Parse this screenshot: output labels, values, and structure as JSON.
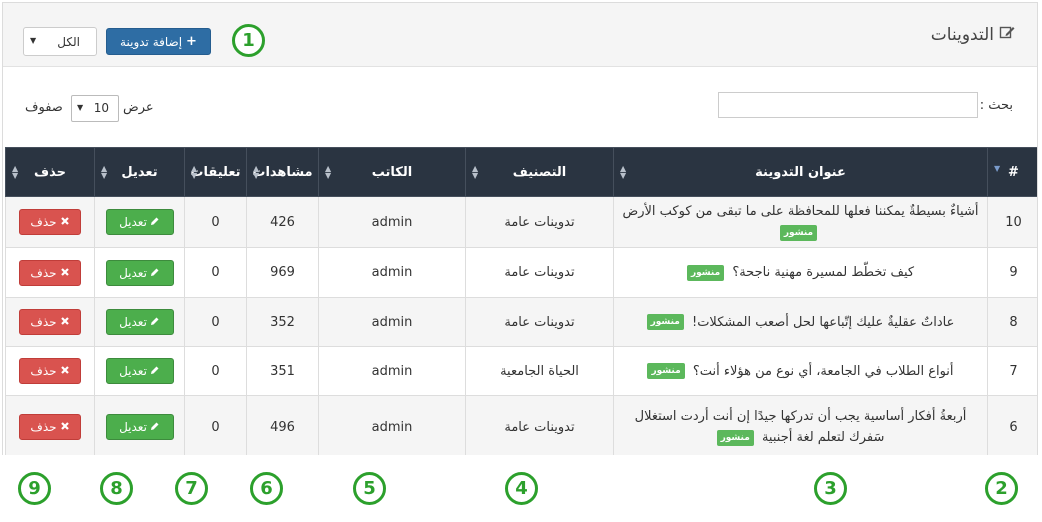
{
  "header": {
    "title": "التدوينات",
    "add_button": "إضافة تدوينة",
    "filter_value": "الكل"
  },
  "controls": {
    "search_label": "بحث :",
    "show_label": "عرض",
    "rows_label": "صفوف",
    "page_length": "10"
  },
  "table": {
    "columns": [
      "#",
      "عنوان التدوينة",
      "التصنيف",
      "الكاتب",
      "مشاهدات",
      "تعليقات",
      "تعديل",
      "حذف"
    ],
    "status_label": "منشور",
    "edit_label": "تعديل",
    "delete_label": "حذف",
    "rows": [
      {
        "id": "10",
        "title": "أشياءٌ بسيطةٌ يمكننا فعلها للمحافظة على ما تبقى من كوكب الأرض",
        "category": "تدوينات عامة",
        "author": "admin",
        "views": "426",
        "comments": "0"
      },
      {
        "id": "9",
        "title": "كيف تخطّط لمسيرة مهنية ناجحة؟",
        "category": "تدوينات عامة",
        "author": "admin",
        "views": "969",
        "comments": "0"
      },
      {
        "id": "8",
        "title": "عاداتٌ عقليةٌ عليك إتّباعها لحل أصعب المشكلات!",
        "category": "تدوينات عامة",
        "author": "admin",
        "views": "352",
        "comments": "0"
      },
      {
        "id": "7",
        "title": "أنواع الطلاب في الجامعة، أي نوع من هؤلاء أنت؟",
        "category": "الحياة الجامعية",
        "author": "admin",
        "views": "351",
        "comments": "0"
      },
      {
        "id": "6",
        "title": "أربعةُ أفكار أساسية يجب أن تدركها جيدًا إن أنت أردت استغلال سَفرك لتعلم لغة أجنبية",
        "category": "تدوينات عامة",
        "author": "admin",
        "views": "496",
        "comments": "0"
      }
    ]
  },
  "callouts": [
    "1",
    "2",
    "3",
    "4",
    "5",
    "6",
    "7",
    "8",
    "9"
  ],
  "colors": {
    "header_dark": "#2a3441",
    "primary": "#2e6da4",
    "success": "#5cb85c",
    "danger": "#d9534f",
    "callout": "#2ca02c"
  }
}
